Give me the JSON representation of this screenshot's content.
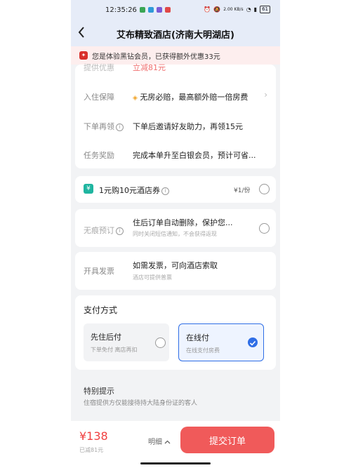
{
  "status_bar": {
    "time": "12:35:26",
    "network_speed": "2.00 KB/s",
    "battery": "61"
  },
  "nav": {
    "back_icon": "chevron-left-icon",
    "title": "艾布精致酒店(济南大明湖店)"
  },
  "notice": {
    "text": "您是体验黑钻会员，已获得额外优惠33元"
  },
  "perks": {
    "partial_label": "提供优惠",
    "partial_value": "立减81元",
    "rows": [
      {
        "label": "入住保障",
        "value": "无房必赔，最高额外赔一倍房费",
        "has_arrow": true
      },
      {
        "label": "下单再领",
        "value": "下单后邀请好友助力，再领15元",
        "has_info": true
      },
      {
        "label": "任务奖励",
        "value": "完成本单升至白银会员，预计可省..."
      }
    ]
  },
  "voucher": {
    "icon": "yen-coupon-icon",
    "label": "1元购10元酒店券",
    "price": "¥1/份"
  },
  "traceless": {
    "label": "无痕预订",
    "value": "住后订单自动删除，保护您...",
    "sub": "同时关闭短信通知，不会获得返现"
  },
  "invoice": {
    "label": "开具发票",
    "value": "如需发票，可向酒店索取",
    "sub": "酒店可提供普票"
  },
  "payment": {
    "title": "支付方式",
    "options": [
      {
        "name": "先住后付",
        "desc": "下单免付 离店再扣",
        "selected": false
      },
      {
        "name": "在线付",
        "desc": "在线支付房费",
        "selected": true
      }
    ],
    "accent": "#2f6ee6"
  },
  "notes": {
    "title": "特别提示",
    "text": "住宿提供方仅能接待持大陆身份证的客人"
  },
  "bottom": {
    "price": "¥138",
    "saved": "已减81元",
    "detail": "明细",
    "submit": "提交订单"
  }
}
